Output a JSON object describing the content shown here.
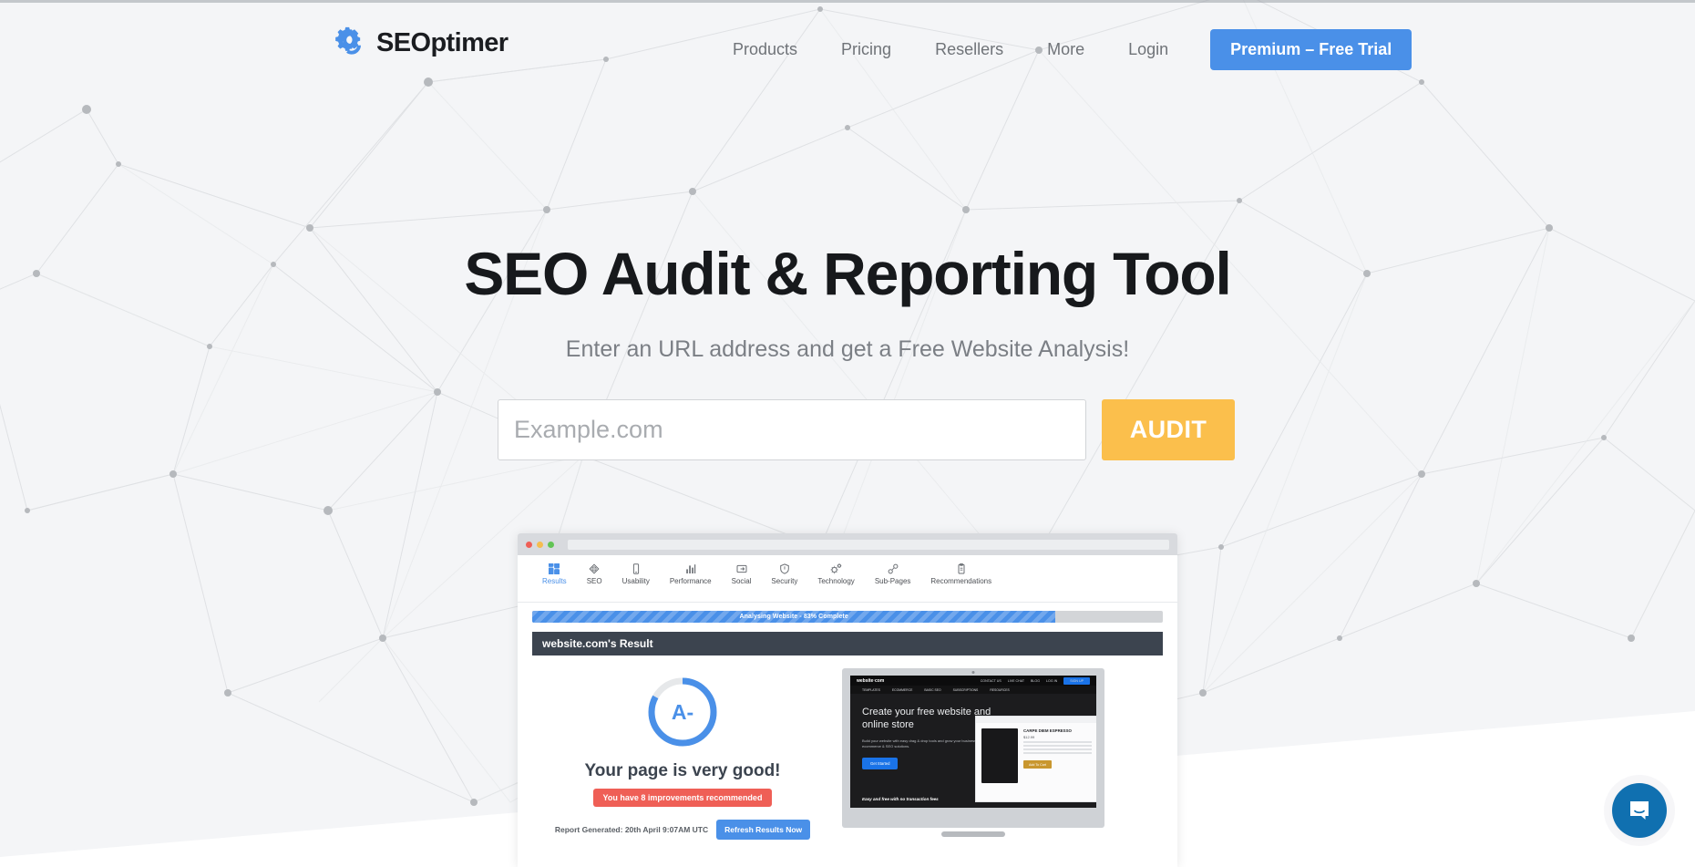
{
  "brand": {
    "name": "SEOptimer",
    "logo_icon": "seoptimer-gear-refresh-icon"
  },
  "nav": {
    "items": [
      {
        "label": "Products"
      },
      {
        "label": "Pricing"
      },
      {
        "label": "Resellers"
      },
      {
        "label": "More"
      },
      {
        "label": "Login"
      }
    ],
    "cta_label": "Premium – Free Trial",
    "cta_color": "#4a90e8"
  },
  "hero": {
    "title": "SEO Audit & Reporting Tool",
    "subtitle": "Enter an URL address and get a Free Website Analysis!"
  },
  "audit_form": {
    "input_value": "",
    "input_placeholder": "Example.com",
    "button_label": "AUDIT",
    "button_color": "#fbbf4c"
  },
  "mockup": {
    "window_dots": [
      "red",
      "yellow",
      "green"
    ],
    "tabs": [
      {
        "label": "Results",
        "icon": "dashboard-grid-icon",
        "active": true
      },
      {
        "label": "SEO",
        "icon": "target-eye-icon",
        "active": false
      },
      {
        "label": "Usability",
        "icon": "mobile-phone-icon",
        "active": false
      },
      {
        "label": "Performance",
        "icon": "bar-chart-icon",
        "active": false
      },
      {
        "label": "Social",
        "icon": "share-media-icon",
        "active": false
      },
      {
        "label": "Security",
        "icon": "shield-icon",
        "active": false
      },
      {
        "label": "Technology",
        "icon": "gears-icon",
        "active": false
      },
      {
        "label": "Sub-Pages",
        "icon": "link-chain-icon",
        "active": false
      },
      {
        "label": "Recommendations",
        "icon": "clipboard-icon",
        "active": false
      }
    ],
    "progress": {
      "label": "Analysing Website - 83% Complete",
      "percent": 83,
      "color": "#4a90e8"
    },
    "result_header": "website.com's Result",
    "score": {
      "grade": "A-",
      "percent": 83,
      "color": "#4a90e8"
    },
    "verdict": "Your page is very good!",
    "improvements_badge": "You have 8 improvements recommended",
    "improvements_color": "#ef5f56",
    "report_generated": "Report Generated: 20th April 9:07AM UTC",
    "refresh_label": "Refresh Results Now",
    "preview": {
      "site_logo": "website·com",
      "top_links": [
        "CONTACT US",
        "LIVE CHAT",
        "BLOG",
        "LOG IN"
      ],
      "top_cta": "SIGN UP",
      "nav_links": [
        "TEMPLATES",
        "ECOMMERCE",
        "BASIC SEO",
        "SUBSCRIPTIONS",
        "RESOURCES"
      ],
      "headline": "Create your free website and online store",
      "paragraph": "Build your website with easy drag & drop tools and grow your business with ecommerce & SEO solutions.",
      "cta": "Get Started",
      "footnote": "Easy and free with no transaction fees",
      "card_title": "CARPE DIEM ESPRESSO",
      "card_price": "$12.99",
      "card_cta": "Add To Cart"
    }
  },
  "support": {
    "widget_label": "intercom-chat-launcher",
    "color": "#1070b0"
  }
}
